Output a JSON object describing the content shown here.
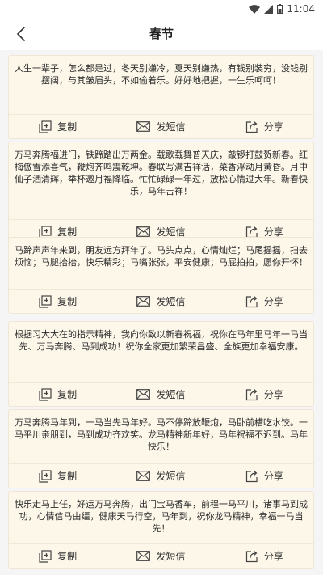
{
  "status_bar": {
    "time": "11:04"
  },
  "header": {
    "title": "春节",
    "back_icon": "back-arrow-icon"
  },
  "actions": {
    "copy": "复制",
    "sms": "发短信",
    "share": "分享"
  },
  "cards": [
    {
      "text": "人生一辈子，怎么都是过，冬天别嫌冷，夏天别嫌热，有钱别装穷，没钱别摆阔，与其皱眉头，不如偷着乐。好好地把握，一生乐呵呵！"
    },
    {
      "text": "万马奔腾福进门，铁蹄踏出万两金。载歌载舞普天庆，敲锣打鼓贺新春。红梅傲雪添喜气，鞭炮齐鸣震乾坤。春联写满吉祥话，菜香浮动月黄昏。月中仙子洒清辉，举杯邀月福降临。忙忙碌碌一年过，放松心情过大年。新春快乐，马年吉祥！"
    },
    {
      "text": "马蹄声声年来到，朋友远方拜年了。马头点点，心情灿烂；马尾摇摇，扫去烦恼；马腿抬抬，快乐精彩；马嘴张张，平安健康；马屁拍拍，愿你开怀！"
    },
    {
      "text": "根据习大大在的指示精神，我向你致以新春祝福，祝你在马年里马年一马当先、万马奔腾、马到成功！祝你全家更加繁荣昌盛、全族更加幸福安康。"
    },
    {
      "text": "万马奔腾马年到，一马当先马年好。马不停蹄放鞭炮，马卧前槽吃水饺。一马平川亲朋到，马到成功齐欢笑。龙马精神新年好，马年祝福不迟到。马年快乐！"
    },
    {
      "text": "快乐走马上任，好运万马奔腾，出门宝马香车，前程一马平川，诸事马到成功，心情信马由缰，健康天马行空，马年到，祝你龙马精神，幸福一马当先！"
    }
  ]
}
